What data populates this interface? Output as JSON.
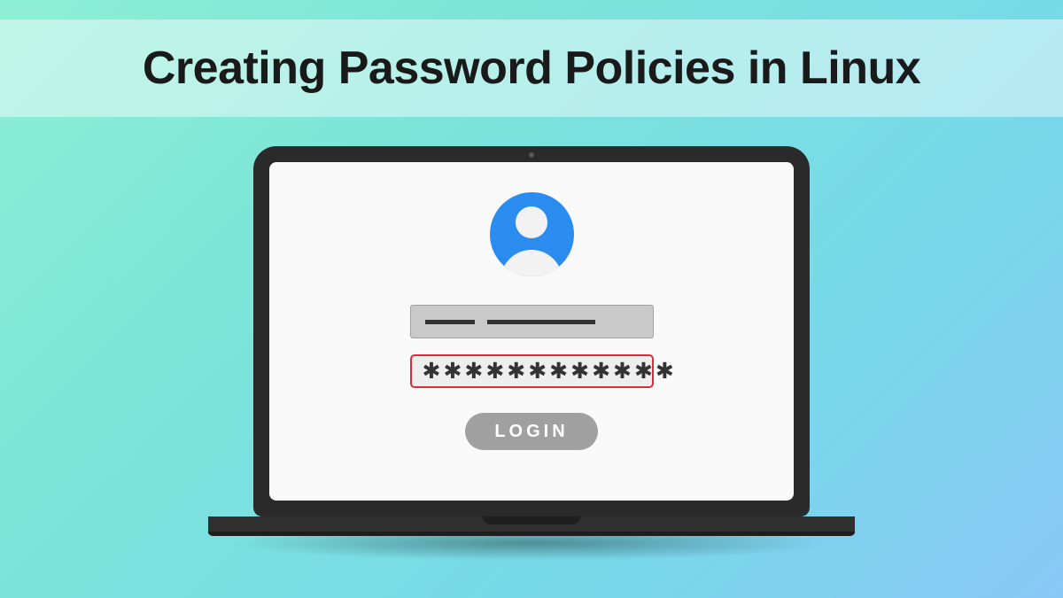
{
  "header": {
    "title": "Creating Password Policies in Linux"
  },
  "login": {
    "password_mask": "✱✱✱✱✱✱✱✱✱✱✱✱",
    "button_label": "LOGIN"
  }
}
